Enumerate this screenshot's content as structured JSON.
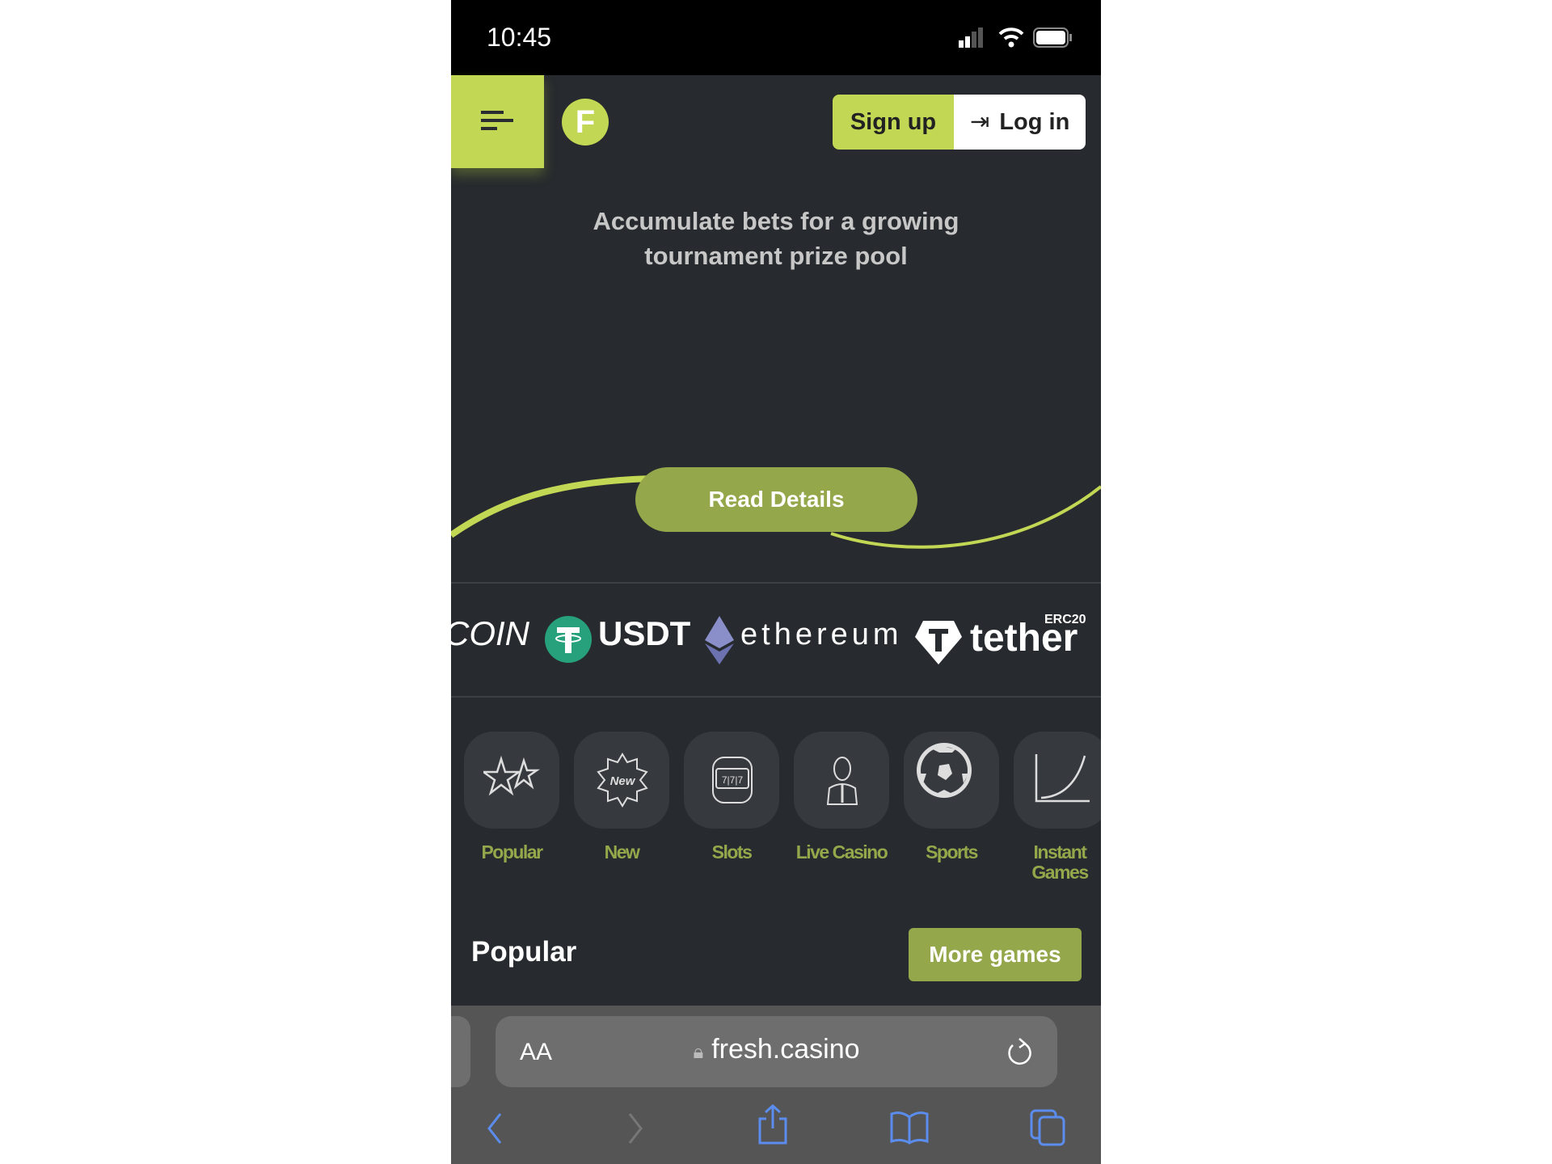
{
  "status_bar": {
    "time": "10:45"
  },
  "header": {
    "logo_letter": "F",
    "signup_label": "Sign up",
    "login_label": "Log in"
  },
  "banner": {
    "headline_line1": "Accumulate bets for a growing",
    "headline_line2": "tournament prize pool",
    "read_details_label": "Read Details"
  },
  "crypto": {
    "coin_partial": "COIN",
    "usdt": "USDT",
    "ethereum": "ethereum",
    "tether": "tether",
    "tether_badge": "ERC20"
  },
  "categories": [
    {
      "label": "Popular"
    },
    {
      "label": "New",
      "icon_text": "New"
    },
    {
      "label": "Slots",
      "icon_text": "7|7|7"
    },
    {
      "label": "Live Casino"
    },
    {
      "label": "Sports"
    },
    {
      "label": "Instant Games"
    }
  ],
  "section": {
    "title": "Popular",
    "more_label": "More games"
  },
  "browser": {
    "aa": "AA",
    "url": "fresh.casino"
  },
  "colors": {
    "accent": "#c2d854",
    "olive": "#94a74a",
    "bg": "#272a2e",
    "ios_blue": "#5b8def"
  }
}
